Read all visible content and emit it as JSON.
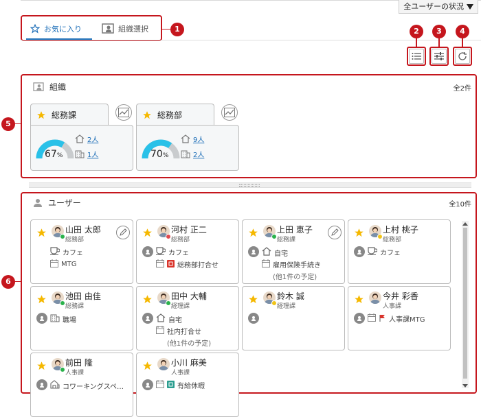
{
  "header": {
    "status_label": "全ユーザーの状況"
  },
  "tabs": [
    {
      "label": "お気に入り",
      "active": true
    },
    {
      "label": "組織選択",
      "active": false
    }
  ],
  "callouts": [
    "1",
    "2",
    "3",
    "4",
    "5",
    "6"
  ],
  "org_panel": {
    "title": "組織",
    "count": "全2件",
    "cards": [
      {
        "name": "総務課",
        "percent": 67,
        "unit": "%",
        "users_count": "2人",
        "office_count": "1人"
      },
      {
        "name": "総務部",
        "percent": 70,
        "unit": "%",
        "users_count": "9人",
        "office_count": "2人"
      }
    ]
  },
  "user_panel": {
    "title": "ユーザー",
    "count": "全10件",
    "users": [
      {
        "name": "山田 太郎",
        "dept": "総務部",
        "status": "green",
        "location": "カフェ",
        "loc_icon": "cup-icon",
        "schedule": "MTG",
        "schedule_icon": "calendar-icon",
        "extra": "",
        "editable": true,
        "show_loc_circle": false
      },
      {
        "name": "河村 正二",
        "dept": "総務部",
        "status": "red",
        "location": "カフェ",
        "loc_icon": "cup-icon",
        "schedule": "総務部打合せ",
        "schedule_icon": "calendar-icon",
        "extra": "",
        "editable": false,
        "show_loc_circle": true,
        "sched_badge": "red-tag-icon"
      },
      {
        "name": "上田 恵子",
        "dept": "総務課",
        "status": "green",
        "location": "自宅",
        "loc_icon": "home-icon",
        "schedule": "雇用保険手続き",
        "schedule_icon": "calendar-icon",
        "extra": "(他1件の予定)",
        "editable": true,
        "show_loc_circle": true
      },
      {
        "name": "上村 桃子",
        "dept": "総務部",
        "status": "yellow",
        "location": "カフェ",
        "loc_icon": "cup-icon",
        "schedule": "",
        "schedule_icon": "",
        "extra": "",
        "editable": false,
        "show_loc_circle": true
      },
      {
        "name": "池田 由佳",
        "dept": "総務課",
        "status": "green",
        "location": "職場",
        "loc_icon": "office-icon",
        "schedule": "",
        "schedule_icon": "",
        "extra": "",
        "editable": false,
        "show_loc_circle": true
      },
      {
        "name": "田中 大輔",
        "dept": "経理課",
        "status": "green",
        "location": "自宅",
        "loc_icon": "home-icon",
        "schedule": "社内打合せ",
        "schedule_icon": "calendar-icon",
        "extra": "(他1件の予定)",
        "editable": false,
        "show_loc_circle": true
      },
      {
        "name": "鈴木 誠",
        "dept": "経理課",
        "status": "yellow",
        "location": "",
        "loc_icon": "",
        "schedule": "",
        "schedule_icon": "",
        "extra": "",
        "editable": false,
        "show_loc_circle": true
      },
      {
        "name": "今井 彩香",
        "dept": "人事課",
        "status": "none",
        "location": "",
        "loc_icon": "",
        "schedule": "人事課MTG",
        "schedule_icon": "calendar-icon",
        "extra": "",
        "editable": false,
        "show_loc_circle": true,
        "sched_badge": "red-flag-icon"
      },
      {
        "name": "前田 隆",
        "dept": "人事課",
        "status": "green",
        "location": "コワーキングスペ…",
        "loc_icon": "coworking-icon",
        "schedule": "",
        "schedule_icon": "",
        "extra": "",
        "editable": false,
        "show_loc_circle": true
      },
      {
        "name": "小川 麻美",
        "dept": "人事課",
        "status": "none",
        "location": "",
        "loc_icon": "",
        "schedule": "有給休暇",
        "schedule_icon": "calendar-icon",
        "extra": "",
        "editable": false,
        "show_loc_circle": true,
        "sched_badge": "green-tag-icon"
      }
    ]
  },
  "colors": {
    "accent": "#1e6fb8",
    "callout": "#c5161d",
    "gauge": "#29c1e8",
    "gauge_bg": "#c9ccce",
    "star": "#f5b800",
    "status_green": "#2bb24c",
    "status_red": "#e0494e",
    "status_yellow": "#f0c419"
  }
}
